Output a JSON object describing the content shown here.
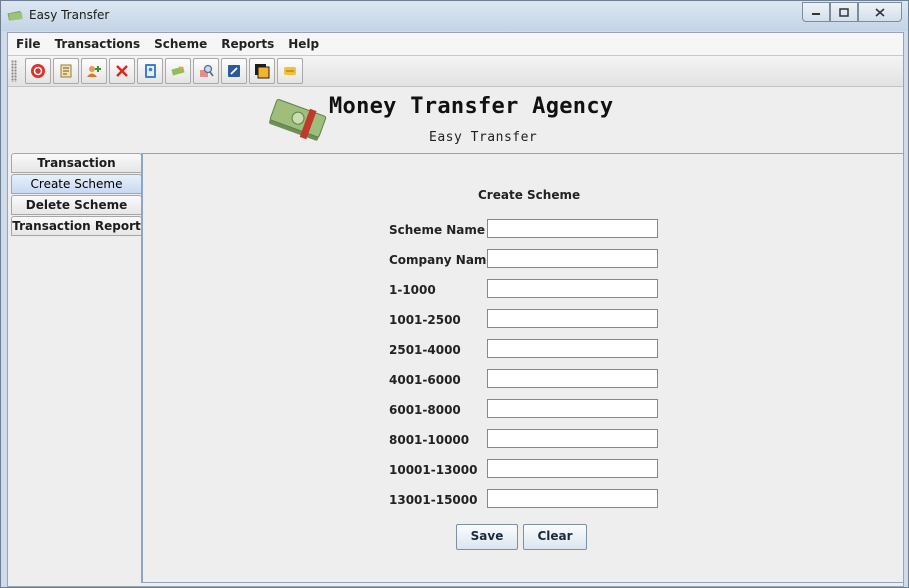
{
  "window": {
    "title": "Easy Transfer"
  },
  "menu": [
    "File",
    "Transactions",
    "Scheme",
    "Reports",
    "Help"
  ],
  "toolbar": [
    {
      "name": "stop-icon"
    },
    {
      "name": "document-icon"
    },
    {
      "name": "add-user-icon"
    },
    {
      "name": "delete-icon"
    },
    {
      "name": "address-book-icon"
    },
    {
      "name": "transfer-icon"
    },
    {
      "name": "search-icon"
    },
    {
      "name": "edit-icon"
    },
    {
      "name": "copy-icon"
    },
    {
      "name": "money-icon"
    }
  ],
  "header": {
    "title": "Money Transfer Agency",
    "subtitle": "Easy Transfer"
  },
  "sidebar": {
    "items": [
      {
        "label": "Transaction",
        "active": false
      },
      {
        "label": "Create Scheme",
        "active": true
      },
      {
        "label": "Delete Scheme",
        "active": false
      },
      {
        "label": "Transaction Report",
        "active": false
      }
    ]
  },
  "form": {
    "title": "Create Scheme",
    "fields": [
      {
        "label": "Scheme Name",
        "value": ""
      },
      {
        "label": "Company Name",
        "value": ""
      },
      {
        "label": "1-1000",
        "value": ""
      },
      {
        "label": "1001-2500",
        "value": ""
      },
      {
        "label": "2501-4000",
        "value": ""
      },
      {
        "label": "4001-6000",
        "value": ""
      },
      {
        "label": "6001-8000",
        "value": ""
      },
      {
        "label": "8001-10000",
        "value": ""
      },
      {
        "label": "10001-13000",
        "value": ""
      },
      {
        "label": "13001-15000",
        "value": ""
      }
    ],
    "save_label": "Save",
    "clear_label": "Clear"
  }
}
